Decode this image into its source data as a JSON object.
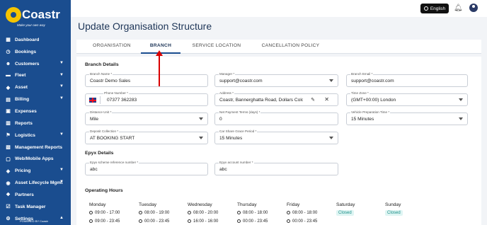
{
  "brand": {
    "name": "Coastr",
    "tagline": "Make your own way"
  },
  "sidebar": {
    "items": [
      {
        "label": "Dashboard",
        "icon": "dashboard-icon",
        "expandable": false
      },
      {
        "label": "Bookings",
        "icon": "calendar-icon",
        "expandable": false
      },
      {
        "label": "Customers",
        "icon": "customers-icon",
        "expandable": true
      },
      {
        "label": "Fleet",
        "icon": "car-icon",
        "expandable": true
      },
      {
        "label": "Asset",
        "icon": "asset-icon",
        "expandable": true
      },
      {
        "label": "Billing",
        "icon": "billing-icon",
        "expandable": true
      },
      {
        "label": "Expenses",
        "icon": "expenses-icon",
        "expandable": false
      },
      {
        "label": "Reports",
        "icon": "reports-icon",
        "expandable": false
      },
      {
        "label": "Logistics",
        "icon": "logistics-icon",
        "expandable": true
      },
      {
        "label": "Management Reports",
        "icon": "chart-icon",
        "expandable": false
      },
      {
        "label": "Web/Mobile Apps",
        "icon": "apps-icon",
        "expandable": false
      },
      {
        "label": "Pricing",
        "icon": "tag-icon",
        "expandable": true
      },
      {
        "label": "Asset Lifecycle Mgmt",
        "icon": "lifecycle-icon",
        "expandable": true
      },
      {
        "label": "Partners",
        "icon": "partners-icon",
        "expandable": false
      },
      {
        "label": "Task Manager",
        "icon": "task-icon",
        "expandable": false
      },
      {
        "label": "Settings",
        "icon": "gear-icon",
        "expandable": true
      }
    ],
    "powered_by": "POWERED BY Coastr"
  },
  "topbar": {
    "language": "English"
  },
  "page": {
    "title": "Update Organisation Structure"
  },
  "tabs": [
    {
      "label": "ORGANISATION",
      "active": false
    },
    {
      "label": "BRANCH",
      "active": true
    },
    {
      "label": "SERVICE LOCATION",
      "active": false
    },
    {
      "label": "CANCELLATION POLICY",
      "active": false
    }
  ],
  "branch_details": {
    "title": "Branch Details",
    "branch_name": {
      "label": "Branch Name *",
      "value": "Coastr Demo Sales"
    },
    "manager": {
      "label": "Manager *",
      "value": "support@coastr.com"
    },
    "branch_email": {
      "label": "Branch Email *",
      "value": "support@coastr.com"
    },
    "phone": {
      "label": "Phone Number *",
      "value": "07377 362283"
    },
    "address": {
      "label": "Address *",
      "value": "Coastr, Bannerghatta Road, Dollars Colony"
    },
    "time_zone": {
      "label": "Time Zone *",
      "value": "(GMT+00:00) London"
    },
    "distance_unit": {
      "label": "Distance Unit *",
      "value": "Mile"
    },
    "net_payment_terms": {
      "label": "Net Payment Terms (days) *",
      "value": "0"
    },
    "vehicle_prep_time": {
      "label": "Vehicle Preparation Time *",
      "value": "15 Minutes"
    },
    "deposit_collection": {
      "label": "Deposit Collection *",
      "value": "AT BOOKING START"
    },
    "car_share_grace": {
      "label": "Car Share Grace Period *",
      "value": "15 Minutes"
    }
  },
  "epyx_details": {
    "title": "Epyx Details",
    "scheme_ref": {
      "label": "Epyx scheme reference number *",
      "value": "abc"
    },
    "account_number": {
      "label": "Epyx account number *",
      "value": "abc"
    }
  },
  "operating_hours": {
    "title": "Operating Hours",
    "days": [
      {
        "day": "Monday",
        "line1": "09:00 - 17:00",
        "line2": "09:00 - 23:45",
        "closed": false
      },
      {
        "day": "Tuesday",
        "line1": "08:00 - 19:00",
        "line2": "00:00 - 23:45",
        "closed": false
      },
      {
        "day": "Wednesday",
        "line1": "08:00 - 20:00",
        "line2": "16:00 - 16:00",
        "closed": false
      },
      {
        "day": "Thursday",
        "line1": "08:00 - 18:00",
        "line2": "00:00 - 23:45",
        "closed": false
      },
      {
        "day": "Friday",
        "line1": "08:00 - 18:00",
        "line2": "00:00 - 23:45",
        "closed": false
      },
      {
        "day": "Saturday",
        "status": "Closed",
        "closed": true
      },
      {
        "day": "Sunday",
        "status": "Closed",
        "closed": true
      }
    ]
  },
  "colors": {
    "sidebar": "#1a4d8f",
    "accent": "#d90000",
    "brand_yellow": "#f5c400"
  }
}
